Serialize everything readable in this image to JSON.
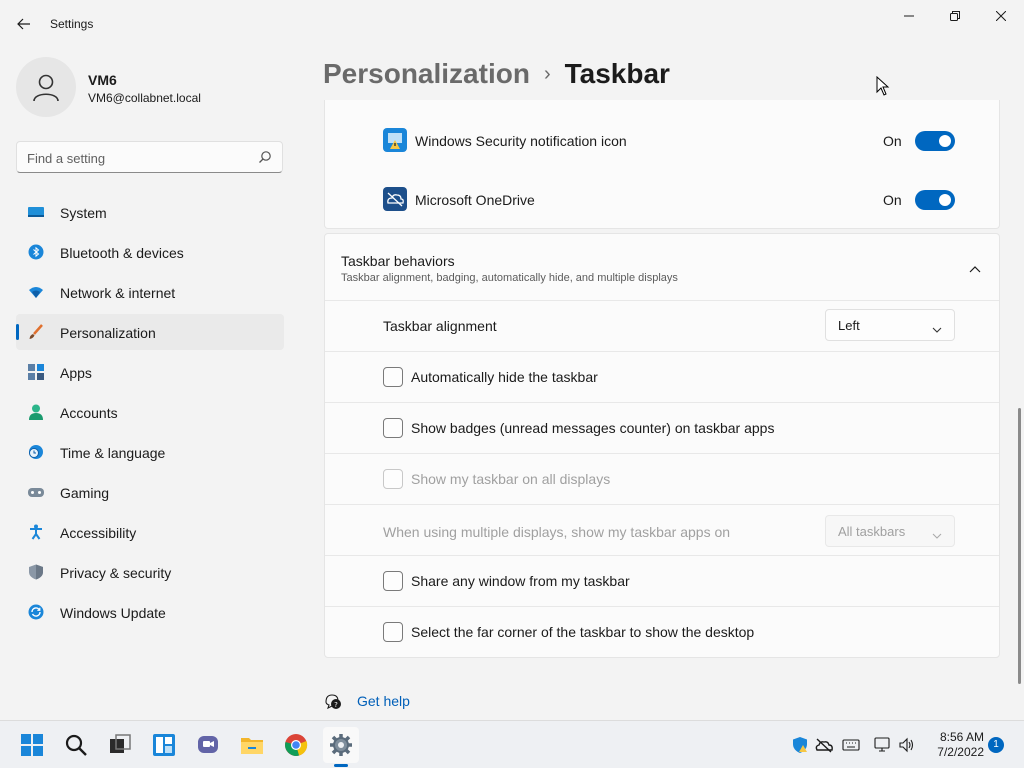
{
  "window": {
    "title": "Settings"
  },
  "profile": {
    "name": "VM6",
    "email": "VM6@collabnet.local"
  },
  "search": {
    "placeholder": "Find a setting"
  },
  "sidebar": {
    "items": [
      {
        "label": "System",
        "icon": "monitor-icon"
      },
      {
        "label": "Bluetooth & devices",
        "icon": "bluetooth-icon"
      },
      {
        "label": "Network & internet",
        "icon": "wifi-icon"
      },
      {
        "label": "Personalization",
        "icon": "brush-icon",
        "selected": true
      },
      {
        "label": "Apps",
        "icon": "apps-icon"
      },
      {
        "label": "Accounts",
        "icon": "person-icon"
      },
      {
        "label": "Time & language",
        "icon": "clock-globe-icon"
      },
      {
        "label": "Gaming",
        "icon": "gamepad-icon"
      },
      {
        "label": "Accessibility",
        "icon": "accessibility-icon"
      },
      {
        "label": "Privacy & security",
        "icon": "shield-icon"
      },
      {
        "label": "Windows Update",
        "icon": "update-icon"
      }
    ]
  },
  "breadcrumb": {
    "parent": "Personalization",
    "separator": "›",
    "current": "Taskbar"
  },
  "tray_icons_section": {
    "rows": [
      {
        "label": "Windows Security notification icon",
        "state": "On",
        "enabled": true
      },
      {
        "label": "Microsoft OneDrive",
        "state": "On",
        "enabled": true
      }
    ]
  },
  "behaviors": {
    "title": "Taskbar behaviors",
    "subtitle": "Taskbar alignment, badging, automatically hide, and multiple displays",
    "alignment_label": "Taskbar alignment",
    "alignment_value": "Left",
    "auto_hide": "Automatically hide the taskbar",
    "badges": "Show badges (unread messages counter) on taskbar apps",
    "all_displays": "Show my taskbar on all displays",
    "multi_display_label": "When using multiple displays, show my taskbar apps on",
    "multi_display_value": "All taskbars",
    "share_window": "Share any window from my taskbar",
    "far_corner": "Select the far corner of the taskbar to show the desktop"
  },
  "help": {
    "label": "Get help"
  },
  "taskbar": {
    "apps": [
      "start-icon",
      "search-icon",
      "task-view-icon",
      "widgets-icon",
      "teams-chat-icon",
      "file-explorer-icon",
      "chrome-icon",
      "settings-icon"
    ],
    "time": "8:56 AM",
    "date": "7/2/2022",
    "notification_count": "1"
  },
  "colors": {
    "accent": "#0067c0",
    "background": "#f3f3f3",
    "card": "#fbfbfb"
  }
}
